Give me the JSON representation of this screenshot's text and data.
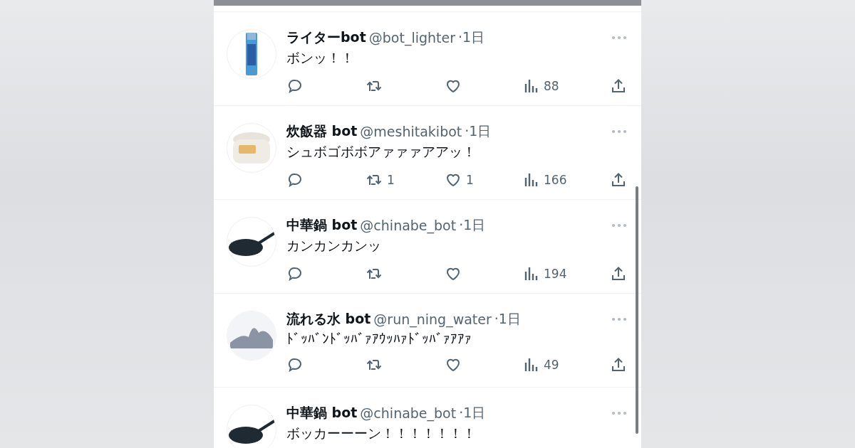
{
  "tweets": [
    {
      "kind": "lighter",
      "name": "ライターbot",
      "handle": "@bot_lighter",
      "time": "·1日",
      "text": "ボンッ！！",
      "views": "88"
    },
    {
      "kind": "rice-cooker",
      "name": "炊飯器 bot",
      "handle": "@meshitakibot",
      "time": "·1日",
      "text": "シュボゴボボアァァァアアッ！",
      "retweets": "1",
      "likes": "1",
      "views": "166"
    },
    {
      "kind": "wok",
      "name": "中華鍋 bot",
      "handle": "@chinabe_bot",
      "time": "·1日",
      "text": "カンカンカンッ",
      "views": "194"
    },
    {
      "kind": "water",
      "name": "流れる水 bot",
      "handle": "@run_ning_water",
      "time": "·1日",
      "text": "ﾄﾞｯﾊﾞﾝﾄﾞｯﾊﾞｧｱｳｯﾊｧﾄﾞｯﾊﾞｧｱｱｧ",
      "views": "49"
    },
    {
      "kind": "wok",
      "name": "中華鍋 bot",
      "handle": "@chinabe_bot",
      "time": "·1日",
      "text": "ボッカーーーン！！！！！！！"
    }
  ]
}
